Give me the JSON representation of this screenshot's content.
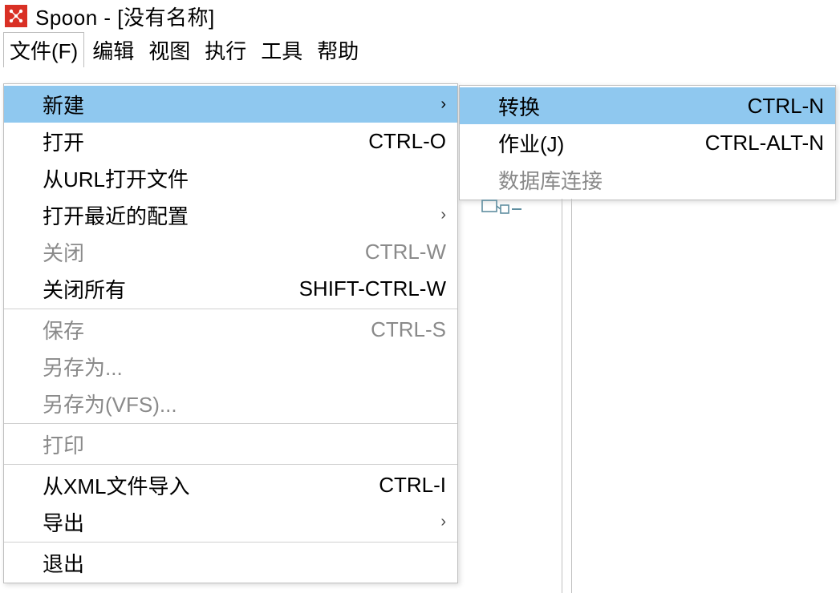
{
  "title": {
    "app_name": "Spoon",
    "separator": " - ",
    "document": "[没有名称]"
  },
  "menubar": {
    "file": "文件(F)",
    "edit": "编辑",
    "view": "视图",
    "run": "执行",
    "tools": "工具",
    "help": "帮助"
  },
  "file_menu": {
    "new_": "新建",
    "open": "打开",
    "open_accel": "CTRL-O",
    "open_from_url": "从URL打开文件",
    "open_recent": "打开最近的配置",
    "close": "关闭",
    "close_accel": "CTRL-W",
    "close_all": "关闭所有",
    "close_all_accel": "SHIFT-CTRL-W",
    "save": "保存",
    "save_accel": "CTRL-S",
    "save_as": "另存为...",
    "save_as_vfs": "另存为(VFS)...",
    "print": "打印",
    "import_xml": "从XML文件导入",
    "import_xml_accel": "CTRL-I",
    "export": "导出",
    "exit": "退出"
  },
  "new_submenu": {
    "transformation": "转换",
    "transformation_accel": "CTRL-N",
    "job": "作业(J)",
    "job_accel": "CTRL-ALT-N",
    "db_connection": "数据库连接"
  },
  "chevron": "›"
}
